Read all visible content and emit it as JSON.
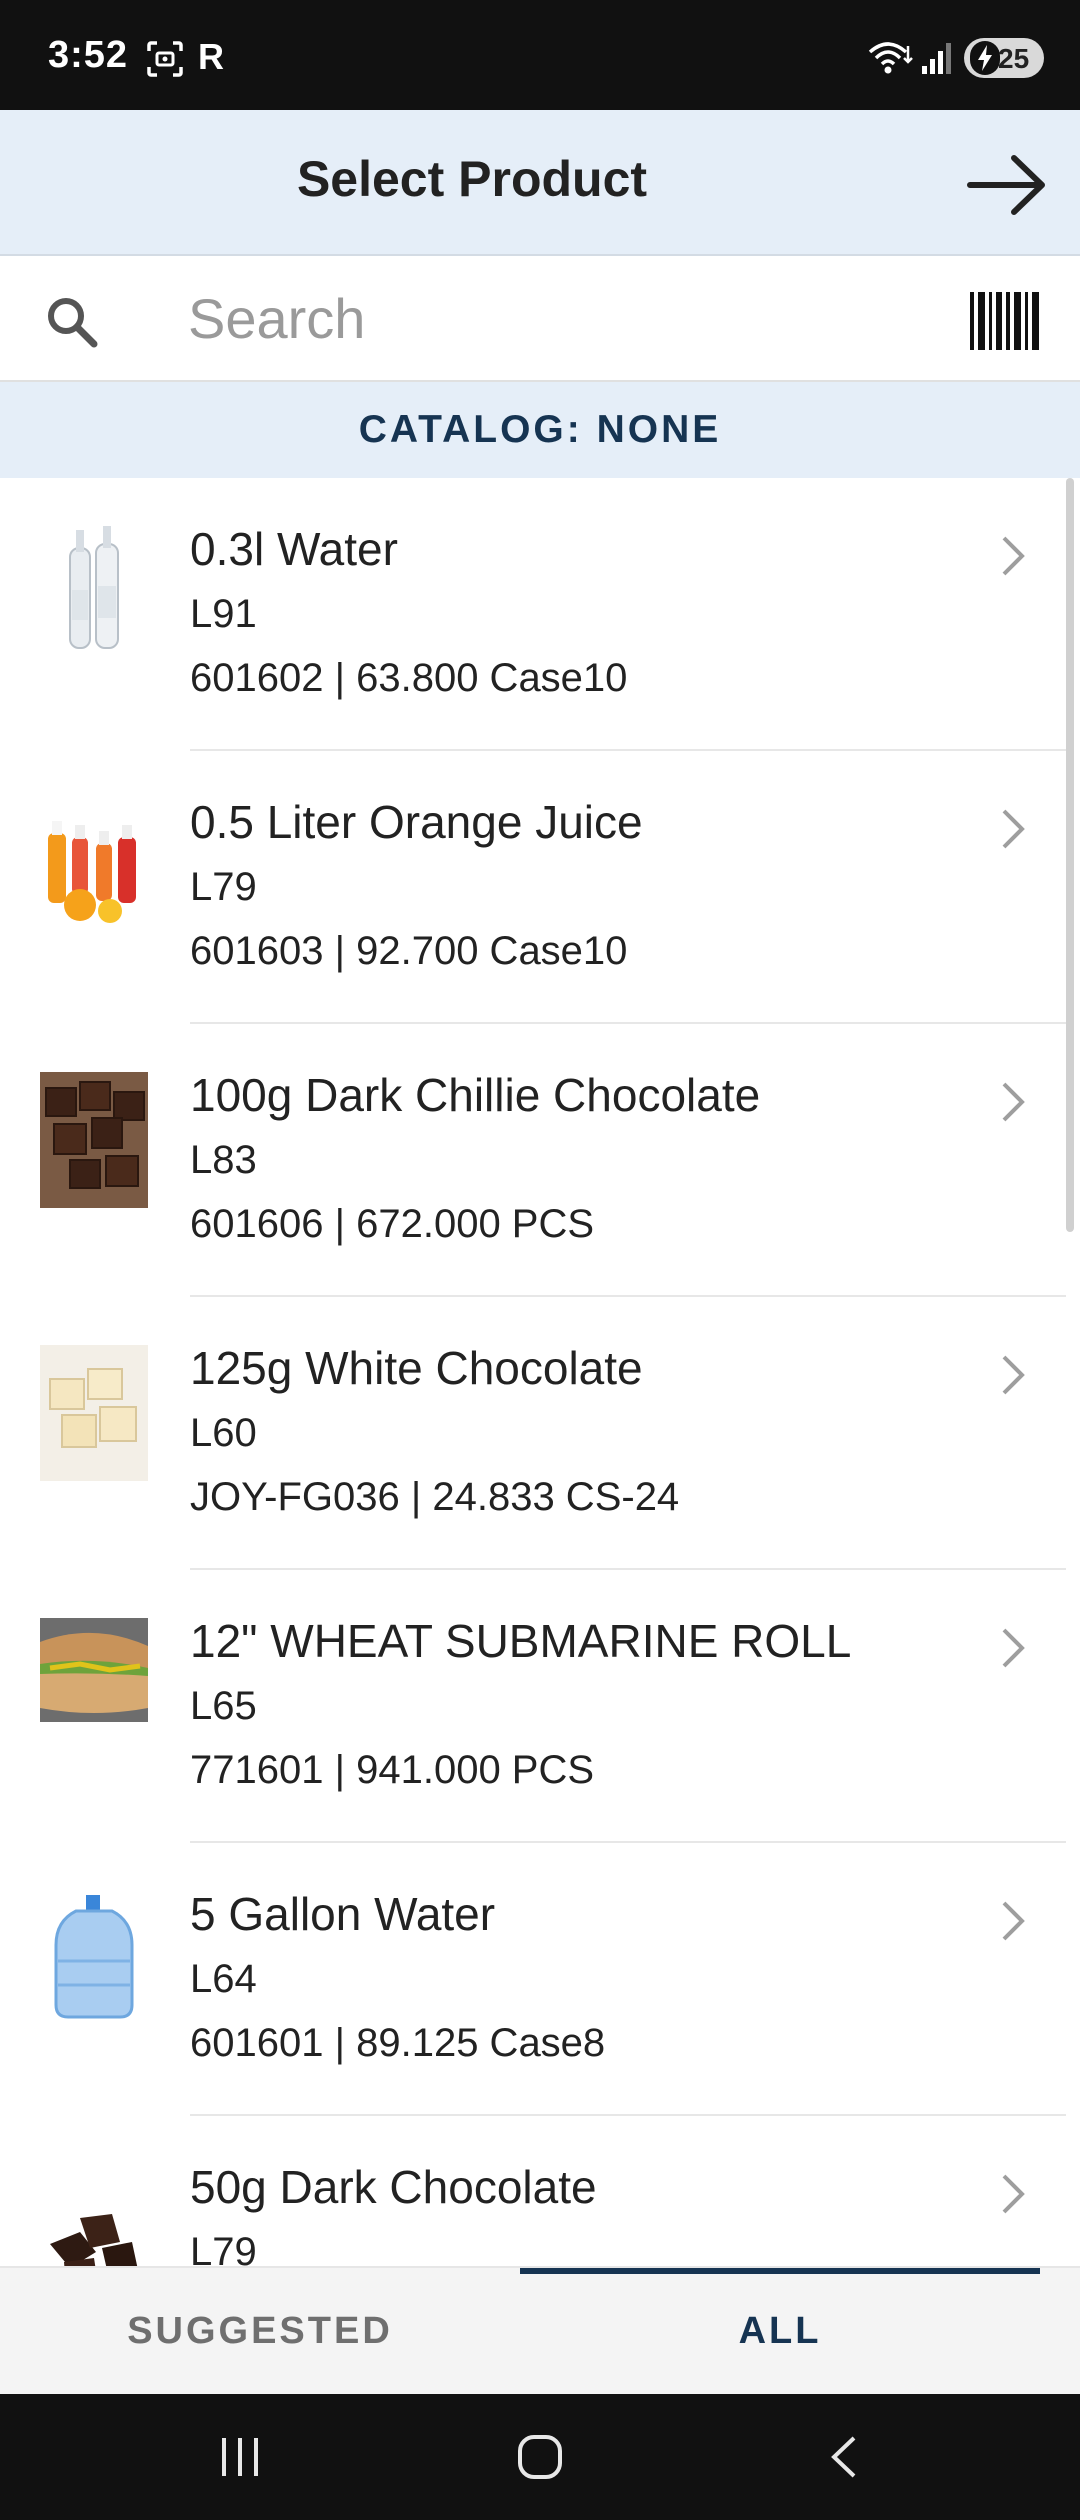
{
  "status_bar": {
    "time": "3:52",
    "carrier_icon_text": "R",
    "battery": "25",
    "icons": [
      "screenshot-icon",
      "wifi-icon",
      "signal-icon",
      "battery-icon"
    ]
  },
  "header": {
    "title": "Select Product",
    "next_icon": "arrow-right-icon"
  },
  "search": {
    "placeholder": "Search",
    "value": "",
    "icons": [
      "search-icon",
      "barcode-icon"
    ]
  },
  "catalog": {
    "label": "CATALOG: NONE"
  },
  "products": [
    {
      "name": "0.3l Water",
      "code": "L91",
      "detail": "601602 | 63.800 Case10",
      "image": "water-bottles"
    },
    {
      "name": "0.5 Liter Orange Juice",
      "code": "L79",
      "detail": "601603 | 92.700 Case10",
      "image": "juice-bottles"
    },
    {
      "name": "100g Dark Chillie Chocolate",
      "code": "L83",
      "detail": "601606 | 672.000 PCS",
      "image": "dark-chocolate-blocks"
    },
    {
      "name": "125g White Chocolate",
      "code": "L60",
      "detail": "JOY-FG036 | 24.833 CS-24",
      "image": "white-chocolate-blocks"
    },
    {
      "name": "12\" WHEAT SUBMARINE ROLL",
      "code": "L65",
      "detail": "771601 | 941.000 PCS",
      "image": "submarine-sandwich"
    },
    {
      "name": "5 Gallon Water",
      "code": "L64",
      "detail": "601601 | 89.125 Case8",
      "image": "water-jug"
    },
    {
      "name": "50g Dark Chocolate",
      "code": "L79",
      "detail": "",
      "image": "dark-chocolate-pieces"
    }
  ],
  "tabs": {
    "suggested": "SUGGESTED",
    "all": "ALL",
    "active": "ALL"
  },
  "colors": {
    "header_bg": "#e5eef8",
    "accent": "#163452",
    "status_bar": "#111111",
    "nav_bar": "#111111"
  },
  "nav": {
    "icons": [
      "recent-apps-icon",
      "home-icon",
      "back-icon"
    ]
  }
}
